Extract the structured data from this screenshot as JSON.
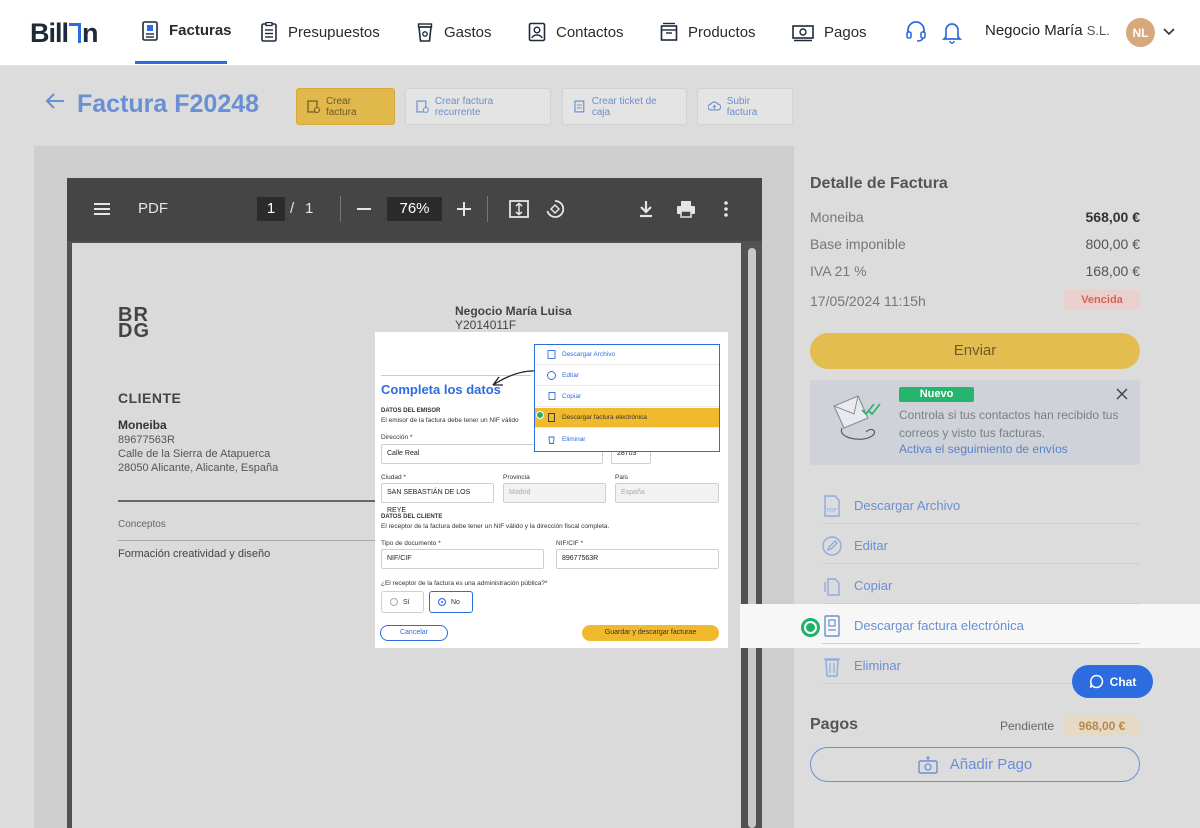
{
  "brand": {
    "logo_text": "Billin",
    "accent": "#2c6ce0"
  },
  "nav": {
    "items": [
      {
        "label": "Facturas",
        "icon": "invoice-icon",
        "active": true
      },
      {
        "label": "Presupuestos",
        "icon": "quote-icon"
      },
      {
        "label": "Gastos",
        "icon": "cup-icon"
      },
      {
        "label": "Contactos",
        "icon": "contact-icon"
      },
      {
        "label": "Productos",
        "icon": "box-icon"
      },
      {
        "label": "Pagos",
        "icon": "money-icon"
      }
    ],
    "company_name": "Negocio María",
    "company_suffix": "S.L.",
    "avatar_initials": "NL"
  },
  "header": {
    "title": "Factura F20248",
    "buttons": {
      "create": "Crear factura",
      "recurrent": "Crear factura recurrente",
      "ticket": "Crear ticket de caja",
      "upload": "Subir factura"
    }
  },
  "pdf": {
    "label": "PDF",
    "page_current": "1",
    "page_sep": "/",
    "page_total": "1",
    "zoom": "76%",
    "logo": "BR\nDG",
    "issuer_name": "Negocio María Luisa",
    "issuer_nif": "Y2014011F",
    "client_heading": "CLIENTE",
    "client_name": "Moneiba",
    "client_nif": "89677563R",
    "client_addr1": "Calle de la Sierra de Atapuerca",
    "client_addr2": "28050 Alicante, Alicante, España",
    "concepts_label": "Conceptos",
    "concept1": "Formación creatividad y diseño"
  },
  "form": {
    "title": "Completa los datos",
    "emisor_h": "DATOS DEL EMISOR",
    "emisor_sub": "El emisor de la factura debe tener un NIF válido",
    "dir_label": "Dirección *",
    "dir_value": "Calle Real",
    "cp_value": "28703",
    "city_label": "Ciudad *",
    "city_value": "SAN SEBASTIÁN DE LOS REYE",
    "prov_label": "Provincia",
    "prov_value": "Madrid",
    "country_label": "País",
    "country_value": "España",
    "cliente_h": "DATOS DEL CLIENTE",
    "cliente_sub": "El receptor de la factura debe tener un NIF válido y la dirección fiscal completa.",
    "doc_label": "Tipo de documento *",
    "doc_value": "NIF/CIF",
    "nif_label": "NIF/CIF *",
    "nif_value": "89677563R",
    "admin_q": "¿El receptor de la factura es una administración pública?*",
    "yes": "Sí",
    "no": "No",
    "cancel": "Cancelar",
    "save": "Guardar y descargar facturae",
    "menu": [
      "Descargar Archivo",
      "Editar",
      "Copiar",
      "Descargar factura electrónica",
      "Eliminar"
    ]
  },
  "detail": {
    "title": "Detalle de Factura",
    "client_label": "Moneiba",
    "client_value": "568,00 €",
    "base_label": "Base imponible",
    "base_value": "800,00 €",
    "iva_label": "IVA 21 %",
    "iva_value": "168,00 €",
    "date": "17/05/2024 11:15h",
    "status": "Vencida",
    "send": "Enviar",
    "promo_badge": "Nuevo",
    "promo_text": "Controla si tus contactos han recibido tus correos y visto tus facturas.",
    "promo_link": "Activa el seguimiento de envíos",
    "actions": [
      "Descargar Archivo",
      "Editar",
      "Copiar",
      "Descargar factura electrónica",
      "Eliminar"
    ],
    "chat": "Chat",
    "pagos_title": "Pagos",
    "pending_label": "Pendiente",
    "pending_value": "968,00 €",
    "add_payment": "Añadir Pago"
  }
}
